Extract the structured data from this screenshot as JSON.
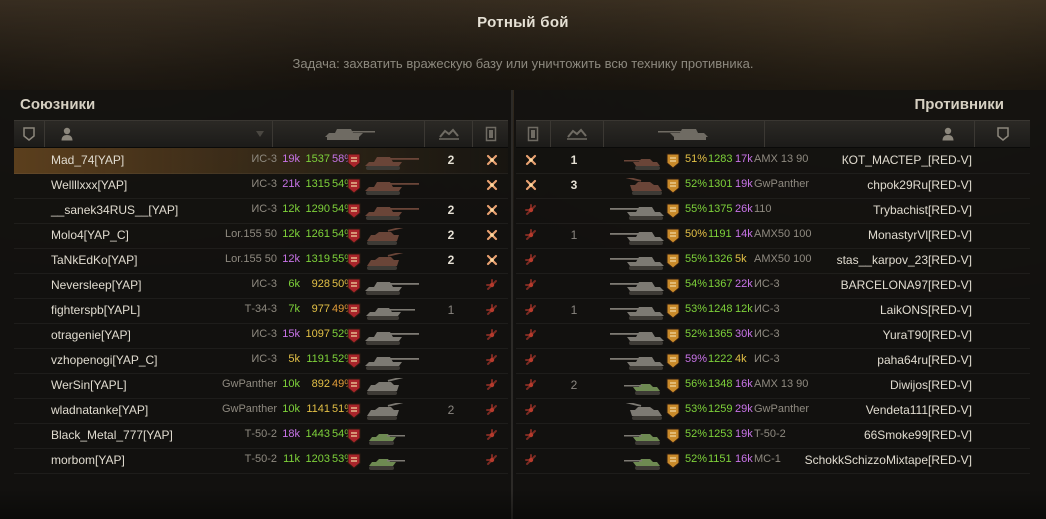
{
  "header": {
    "title": "Ротный бой",
    "task": "Задача: захватить вражескую базу или уничтожить всю технику противника."
  },
  "teams": {
    "allies_title": "Союзники",
    "enemies_title": "Противники"
  },
  "colors": {
    "purple": "#c874e8",
    "green": "#7ed23a",
    "yellow": "#e2c046",
    "orange": "#e09b38",
    "white": "#d8d4ca"
  },
  "allies": [
    {
      "name": "Mad_74[YAP]",
      "vehicle": "ИС-3",
      "battles": "19k",
      "wn8": "1537",
      "winrate": "58%",
      "frags": "2",
      "alive": false,
      "highlight": true,
      "c_battles": "purple",
      "c_wn8": "green",
      "c_wr": "purple",
      "tank": "heavy"
    },
    {
      "name": "Wellllxxx[YAP]",
      "vehicle": "ИС-3",
      "battles": "21k",
      "wn8": "1315",
      "winrate": "54%",
      "frags": "",
      "alive": false,
      "c_battles": "purple",
      "c_wn8": "green",
      "c_wr": "green",
      "tank": "heavy"
    },
    {
      "name": "__sanek34RUS__[YAP]",
      "vehicle": "ИС-3",
      "battles": "12k",
      "wn8": "1290",
      "winrate": "54%",
      "frags": "2",
      "alive": false,
      "c_battles": "green",
      "c_wn8": "green",
      "c_wr": "green",
      "tank": "heavy"
    },
    {
      "name": "Molo4[YAP_C]",
      "vehicle": "Lor.155 50",
      "battles": "12k",
      "wn8": "1261",
      "winrate": "54%",
      "frags": "2",
      "alive": false,
      "c_battles": "green",
      "c_wn8": "green",
      "c_wr": "green",
      "tank": "spg"
    },
    {
      "name": "TaNkEdKo[YAP]",
      "vehicle": "Lor.155 50",
      "battles": "12k",
      "wn8": "1319",
      "winrate": "55%",
      "frags": "2",
      "alive": false,
      "c_battles": "purple",
      "c_wn8": "green",
      "c_wr": "green",
      "tank": "spg"
    },
    {
      "name": "Neversleep[YAP]",
      "vehicle": "ИС-3",
      "battles": "6k",
      "wn8": "928",
      "winrate": "50%",
      "frags": "",
      "alive": true,
      "c_battles": "green",
      "c_wn8": "yellow",
      "c_wr": "yellow",
      "tank": "heavy"
    },
    {
      "name": "fighterspb[YAPL]",
      "vehicle": "Т-34-3",
      "battles": "7k",
      "wn8": "977",
      "winrate": "49%",
      "frags": "1",
      "fragsDim": true,
      "alive": true,
      "c_battles": "green",
      "c_wn8": "yellow",
      "c_wr": "orange",
      "tank": "medium"
    },
    {
      "name": "otragenie[YAP]",
      "vehicle": "ИС-3",
      "battles": "15k",
      "wn8": "1097",
      "winrate": "52%",
      "frags": "",
      "alive": true,
      "c_battles": "purple",
      "c_wn8": "yellow",
      "c_wr": "green",
      "tank": "heavy"
    },
    {
      "name": "vzhopenogi[YAP_C]",
      "vehicle": "ИС-3",
      "battles": "5k",
      "wn8": "1191",
      "winrate": "52%",
      "frags": "",
      "alive": true,
      "c_battles": "yellow",
      "c_wn8": "green",
      "c_wr": "green",
      "tank": "heavy"
    },
    {
      "name": "WerSin[YAPL]",
      "vehicle": "GwPanther",
      "battles": "10k",
      "wn8": "892",
      "winrate": "49%",
      "frags": "",
      "alive": true,
      "c_battles": "green",
      "c_wn8": "yellow",
      "c_wr": "orange",
      "tank": "spg"
    },
    {
      "name": "wladnatanke[YAP]",
      "vehicle": "GwPanther",
      "battles": "10k",
      "wn8": "1141",
      "winrate": "51%",
      "frags": "2",
      "fragsDim": true,
      "alive": true,
      "c_battles": "green",
      "c_wn8": "yellow",
      "c_wr": "yellow",
      "tank": "spg"
    },
    {
      "name": "Black_Metal_777[YAP]",
      "vehicle": "Т-50-2",
      "battles": "18k",
      "wn8": "1443",
      "winrate": "54%",
      "frags": "",
      "alive": true,
      "c_battles": "purple",
      "c_wn8": "green",
      "c_wr": "green",
      "tank": "light"
    },
    {
      "name": "morbom[YAP]",
      "vehicle": "Т-50-2",
      "battles": "11k",
      "wn8": "1203",
      "winrate": "53%",
      "frags": "",
      "alive": true,
      "c_battles": "green",
      "c_wn8": "green",
      "c_wr": "green",
      "tank": "light"
    }
  ],
  "enemies": [
    {
      "name": "КОТ_МАСТЕР_[RED-V]",
      "vehicle": "AMX 13 90",
      "battles": "17k",
      "wn8": "1283",
      "winrate": "51%",
      "frags": "1",
      "alive": false,
      "c_battles": "purple",
      "c_wn8": "green",
      "c_wr": "yellow",
      "tank": "light"
    },
    {
      "name": "chpok29Ru[RED-V]",
      "vehicle": "GwPanther",
      "battles": "19k",
      "wn8": "1301",
      "winrate": "52%",
      "frags": "3",
      "alive": false,
      "c_battles": "purple",
      "c_wn8": "green",
      "c_wr": "green",
      "tank": "spg"
    },
    {
      "name": "Trybachist[RED-V]",
      "vehicle": "110",
      "battles": "26k",
      "wn8": "1375",
      "winrate": "55%",
      "frags": "",
      "alive": true,
      "c_battles": "purple",
      "c_wn8": "green",
      "c_wr": "green",
      "tank": "heavy"
    },
    {
      "name": "MonastyrVl[RED-V]",
      "vehicle": "AMX50 100",
      "battles": "14k",
      "wn8": "1191",
      "winrate": "50%",
      "frags": "1",
      "fragsDim": true,
      "alive": true,
      "c_battles": "purple",
      "c_wn8": "green",
      "c_wr": "yellow",
      "tank": "heavy"
    },
    {
      "name": "stas__karpov_23[RED-V]",
      "vehicle": "AMX50 100",
      "battles": "5k",
      "wn8": "1326",
      "winrate": "55%",
      "frags": "",
      "alive": true,
      "c_battles": "yellow",
      "c_wn8": "green",
      "c_wr": "green",
      "tank": "heavy"
    },
    {
      "name": "BARCELONA97[RED-V]",
      "vehicle": "ИС-3",
      "battles": "22k",
      "wn8": "1367",
      "winrate": "54%",
      "frags": "",
      "alive": true,
      "c_battles": "purple",
      "c_wn8": "green",
      "c_wr": "green",
      "tank": "heavy"
    },
    {
      "name": "LaikONS[RED-V]",
      "vehicle": "ИС-3",
      "battles": "12k",
      "wn8": "1248",
      "winrate": "53%",
      "frags": "1",
      "fragsDim": true,
      "alive": true,
      "c_battles": "green",
      "c_wn8": "green",
      "c_wr": "green",
      "tank": "heavy"
    },
    {
      "name": "YuraT90[RED-V]",
      "vehicle": "ИС-3",
      "battles": "30k",
      "wn8": "1365",
      "winrate": "52%",
      "frags": "",
      "alive": true,
      "c_battles": "purple",
      "c_wn8": "green",
      "c_wr": "green",
      "tank": "heavy"
    },
    {
      "name": "paha64ru[RED-V]",
      "vehicle": "ИС-3",
      "battles": "4k",
      "wn8": "1222",
      "winrate": "59%",
      "frags": "",
      "alive": true,
      "c_battles": "yellow",
      "c_wn8": "green",
      "c_wr": "purple",
      "tank": "heavy"
    },
    {
      "name": "Diwijos[RED-V]",
      "vehicle": "AMX 13 90",
      "battles": "16k",
      "wn8": "1348",
      "winrate": "56%",
      "frags": "2",
      "fragsDim": true,
      "alive": true,
      "c_battles": "purple",
      "c_wn8": "green",
      "c_wr": "green",
      "tank": "light"
    },
    {
      "name": "Vendeta111[RED-V]",
      "vehicle": "GwPanther",
      "battles": "29k",
      "wn8": "1259",
      "winrate": "53%",
      "frags": "",
      "alive": true,
      "c_battles": "purple",
      "c_wn8": "green",
      "c_wr": "green",
      "tank": "spg"
    },
    {
      "name": "66Smoke99[RED-V]",
      "vehicle": "T-50-2",
      "battles": "19k",
      "wn8": "1253",
      "winrate": "52%",
      "frags": "",
      "alive": true,
      "c_battles": "purple",
      "c_wn8": "green",
      "c_wr": "green",
      "tank": "light"
    },
    {
      "name": "SchokkSchizzoMixtape[RED-V]",
      "vehicle": "МС-1",
      "battles": "16k",
      "wn8": "1151",
      "winrate": "52%",
      "frags": "",
      "alive": true,
      "c_battles": "purple",
      "c_wn8": "green",
      "c_wr": "green",
      "tank": "light"
    }
  ]
}
